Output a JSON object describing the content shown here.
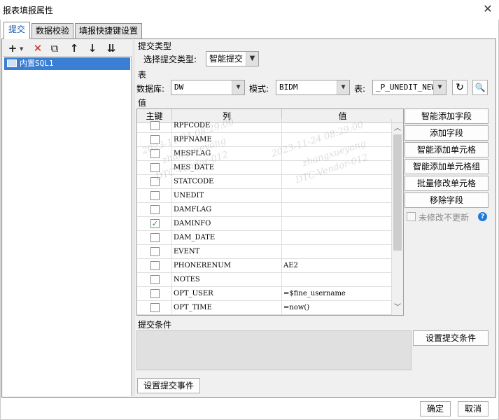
{
  "window": {
    "title": "报表填报属性",
    "close_icon": "✕"
  },
  "tabs": [
    {
      "label": "提交",
      "active": true
    },
    {
      "label": "数据校验",
      "active": false
    },
    {
      "label": "填报快捷键设置",
      "active": false
    }
  ],
  "left_toolbar": {
    "add": "+",
    "delete": "✕",
    "copy": "⧉",
    "up": "↑",
    "down": "↓",
    "sort": "⇊"
  },
  "tree": {
    "items": [
      {
        "label": "内置SQL1"
      }
    ]
  },
  "submit_type": {
    "section": "提交类型",
    "label": "选择提交类型:",
    "value": "智能提交"
  },
  "table_section": {
    "section": "表",
    "db_label": "数据库:",
    "db_value": "DW",
    "mode_label": "模式:",
    "mode_value": "BIDM",
    "table_label": "表:",
    "table_value": "_P_UNEDIT_NEW"
  },
  "values": {
    "section": "值",
    "headers": {
      "key": "主键",
      "column": "列",
      "value": "值"
    },
    "rows": [
      {
        "column": "RPFCODE",
        "value": "",
        "checked": false
      },
      {
        "column": "RPFNAME",
        "value": "",
        "checked": false
      },
      {
        "column": "MESFLAG",
        "value": "",
        "checked": false
      },
      {
        "column": "MES_DATE",
        "value": "",
        "checked": false
      },
      {
        "column": "STATCODE",
        "value": "",
        "checked": false
      },
      {
        "column": "UNEDIT",
        "value": "",
        "checked": false
      },
      {
        "column": "DAMFLAG",
        "value": "",
        "checked": false
      },
      {
        "column": "DAMINFO",
        "value": "",
        "checked": true
      },
      {
        "column": "DAM_DATE",
        "value": "",
        "checked": false
      },
      {
        "column": "EVENT",
        "value": "",
        "checked": false
      },
      {
        "column": "PHONERENUM",
        "value": "AE2",
        "checked": false
      },
      {
        "column": "NOTES",
        "value": "",
        "checked": false
      },
      {
        "column": "OPT_USER",
        "value": "=$fine_username",
        "checked": false
      },
      {
        "column": "OPT_TIME",
        "value": "=now()",
        "checked": false
      }
    ]
  },
  "side_buttons": {
    "smart_add_field": "智能添加字段",
    "add_field": "添加字段",
    "smart_add_cell": "智能添加单元格",
    "smart_add_cell_group": "智能添加单元格组",
    "batch_modify_cell": "批量修改单元格",
    "remove_field": "移除字段",
    "no_update_label": "未修改不更新",
    "help": "?"
  },
  "condition": {
    "section": "提交条件",
    "button": "设置提交条件"
  },
  "event_button": "设置提交事件",
  "footer": {
    "ok": "确定",
    "cancel": "取消"
  },
  "watermark": {
    "time": "2023-11-24 08:29:00",
    "user": "zhangxueyang",
    "vendor": "DTC-Vendor-012"
  }
}
